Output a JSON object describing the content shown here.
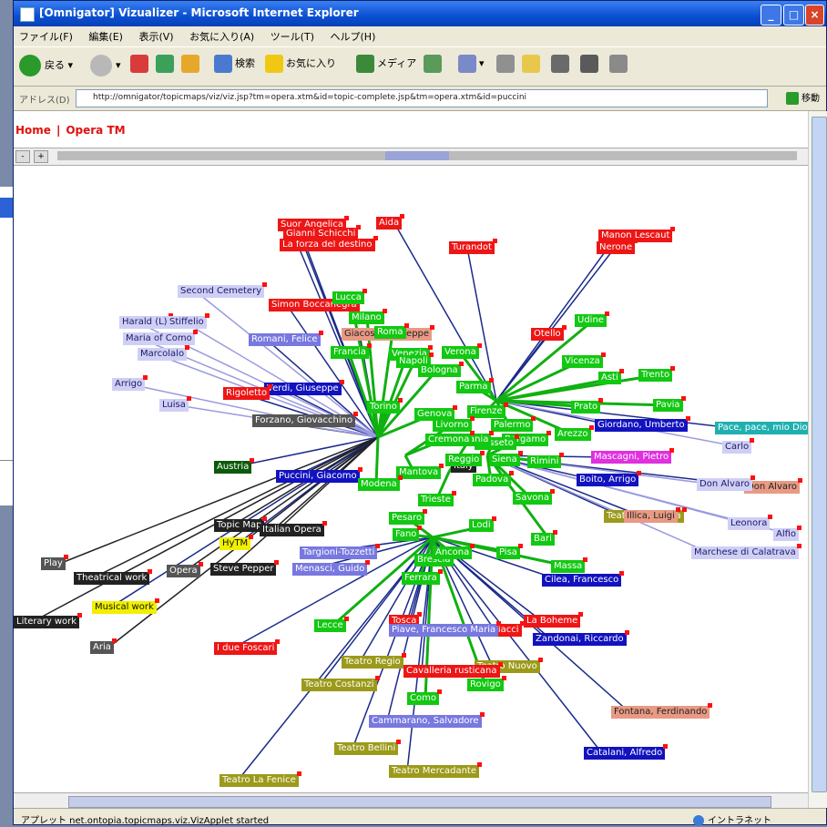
{
  "window": {
    "title": "[Omnigator] Vizualizer - Microsoft Internet Explorer"
  },
  "menu": [
    "ファイル(F)",
    "編集(E)",
    "表示(V)",
    "お気に入り(A)",
    "ツール(T)",
    "ヘルプ(H)"
  ],
  "toolbar": {
    "back": "戻る",
    "search": "検索",
    "favorites": "お気に入り",
    "media": "メディア"
  },
  "address": {
    "label": "アドレス(D)",
    "url": "http://omnigator/topicmaps/viz/viz.jsp?tm=opera.xtm&id=topic-complete.jsp&tm=opera.xtm&id=puccini",
    "go": "移動"
  },
  "breadcrumb": {
    "home": "Home",
    "topicmap": "Opera TM"
  },
  "status": {
    "text": "アプレット net.ontopia.topicmaps.viz.VizApplet started",
    "zone": "イントラネット"
  },
  "icons": [
    "back-icon",
    "forward-icon",
    "stop-icon",
    "refresh-icon",
    "home-icon",
    "search-icon",
    "favorites-icon",
    "media-icon",
    "history-icon",
    "mail-icon",
    "print-icon",
    "edit-icon",
    "go-icon",
    "zone-icon"
  ],
  "colors": {
    "composer": "#12c812",
    "opera": "#ee1515",
    "theatre": "#9c9a1a",
    "person": "#1212c0",
    "librettist": "#7878e0",
    "character": "#cfcff6",
    "selected": "#222222"
  },
  "graph": {
    "nodes": [
      {
        "label": "Puccini, Giacomo",
        "cls": "c-b"
      },
      {
        "label": "Verdi, Giuseppe",
        "cls": "c-b"
      },
      {
        "label": "Tosca",
        "cls": "c-r"
      },
      {
        "label": "La Boheme",
        "cls": "c-r"
      },
      {
        "label": "Turandot",
        "cls": "c-r"
      },
      {
        "label": "Italy",
        "cls": "c-k"
      },
      {
        "label": "Teatro La Fenice",
        "cls": "c-o"
      },
      {
        "label": "Teatro Costanzi",
        "cls": "c-o"
      },
      {
        "label": "Teatro Regio",
        "cls": "c-o"
      },
      {
        "label": "Teatro alla Scala",
        "cls": "c-o"
      },
      {
        "label": "Teatro Nuovo",
        "cls": "c-o"
      },
      {
        "label": "Teatro Bellini",
        "cls": "c-o"
      },
      {
        "label": "Teatro Mercadante",
        "cls": "c-o"
      },
      {
        "label": "Simon Boccanegra",
        "cls": "c-r"
      },
      {
        "label": "La forza del destino",
        "cls": "c-r"
      },
      {
        "label": "Rigoletto",
        "cls": "c-r"
      },
      {
        "label": "Otello",
        "cls": "c-r"
      },
      {
        "label": "Aida",
        "cls": "c-r"
      },
      {
        "label": "Nerone",
        "cls": "c-r"
      },
      {
        "label": "Pagliacci",
        "cls": "c-r"
      },
      {
        "label": "Manon Lescaut",
        "cls": "c-r"
      },
      {
        "label": "Suor Angelica",
        "cls": "c-r"
      },
      {
        "label": "Gianni Schicchi",
        "cls": "c-r"
      },
      {
        "label": "Cavalleria rusticana",
        "cls": "c-r"
      },
      {
        "label": "I due Foscari",
        "cls": "c-r"
      },
      {
        "label": "Don Alvaro",
        "cls": "c-s"
      },
      {
        "label": "Boito, Arrigo",
        "cls": "c-b"
      },
      {
        "label": "Giordano, Umberto",
        "cls": "c-b"
      },
      {
        "label": "Cilea, Francesco",
        "cls": "c-b"
      },
      {
        "label": "Zandonai, Riccardo",
        "cls": "c-b"
      },
      {
        "label": "Catalani, Alfredo",
        "cls": "c-b"
      },
      {
        "label": "Illica, Luigi",
        "cls": "c-s"
      },
      {
        "label": "Giacosa, Giuseppe",
        "cls": "c-s"
      },
      {
        "label": "Fontana, Ferdinando",
        "cls": "c-s"
      },
      {
        "label": "Romani, Felice",
        "cls": "c-p"
      },
      {
        "label": "Piave, Francesco Maria",
        "cls": "c-p"
      },
      {
        "label": "Cammarano, Salvadore",
        "cls": "c-p"
      },
      {
        "label": "Targioni-Tozzetti",
        "cls": "c-p"
      },
      {
        "label": "Menasci, Guido",
        "cls": "c-p"
      },
      {
        "label": "Forzano, Giovacchino",
        "cls": "c-d"
      },
      {
        "label": "Mascagni, Pietro",
        "cls": "c-m"
      },
      {
        "label": "Pace, pace, mio Dio",
        "cls": "c-t"
      },
      {
        "label": "Topic Map",
        "cls": "c-k"
      },
      {
        "label": "Italian Opera",
        "cls": "c-k"
      },
      {
        "label": "HyTM",
        "cls": "c-y"
      },
      {
        "label": "Steve Pepper",
        "cls": "c-k"
      },
      {
        "label": "Opera",
        "cls": "c-d"
      },
      {
        "label": "Theatrical work",
        "cls": "c-k"
      },
      {
        "label": "Musical work",
        "cls": "c-y"
      },
      {
        "label": "Aria",
        "cls": "c-d"
      },
      {
        "label": "Play",
        "cls": "c-d"
      },
      {
        "label": "Literary work",
        "cls": "c-k"
      },
      {
        "label": "Second Cemetery",
        "cls": "c-l"
      },
      {
        "label": "Harald (L)",
        "cls": "c-l"
      },
      {
        "label": "Stiffelio",
        "cls": "c-l"
      },
      {
        "label": "Maria of Como",
        "cls": "c-l"
      },
      {
        "label": "Marcolalo",
        "cls": "c-l"
      },
      {
        "label": "Arrigo",
        "cls": "c-l"
      },
      {
        "label": "Luisa",
        "cls": "c-l"
      },
      {
        "label": "Carlo",
        "cls": "c-l"
      },
      {
        "label": "Don Alvaro",
        "cls": "c-l"
      },
      {
        "label": "Marchese di Calatrava",
        "cls": "c-l"
      },
      {
        "label": "Leonora",
        "cls": "c-l"
      },
      {
        "label": "Alfio",
        "cls": "c-l"
      },
      {
        "label": "Lucca",
        "cls": "c-g"
      },
      {
        "label": "Milano",
        "cls": "c-g"
      },
      {
        "label": "Roma",
        "cls": "c-g"
      },
      {
        "label": "Venezia",
        "cls": "c-g"
      },
      {
        "label": "Napoli",
        "cls": "c-g"
      },
      {
        "label": "Bologna",
        "cls": "c-g"
      },
      {
        "label": "Parma",
        "cls": "c-g"
      },
      {
        "label": "Verona",
        "cls": "c-g"
      },
      {
        "label": "Genova",
        "cls": "c-g"
      },
      {
        "label": "Torino",
        "cls": "c-g"
      },
      {
        "label": "Firenze",
        "cls": "c-g"
      },
      {
        "label": "Livorno",
        "cls": "c-g"
      },
      {
        "label": "Palermo",
        "cls": "c-g"
      },
      {
        "label": "Bergamo",
        "cls": "c-g"
      },
      {
        "label": "Busseto",
        "cls": "c-g"
      },
      {
        "label": "Catania",
        "cls": "c-g"
      },
      {
        "label": "Cremona",
        "cls": "c-g"
      },
      {
        "label": "Reggio",
        "cls": "c-g"
      },
      {
        "label": "Siena",
        "cls": "c-g"
      },
      {
        "label": "Padova",
        "cls": "c-g"
      },
      {
        "label": "Mantova",
        "cls": "c-g"
      },
      {
        "label": "Modena",
        "cls": "c-g"
      },
      {
        "label": "Trieste",
        "cls": "c-g"
      },
      {
        "label": "Pesaro",
        "cls": "c-g"
      },
      {
        "label": "Brescia",
        "cls": "c-g"
      },
      {
        "label": "Ferrara",
        "cls": "c-g"
      },
      {
        "label": "Lecce",
        "cls": "c-g"
      },
      {
        "label": "Rovigo",
        "cls": "c-g"
      },
      {
        "label": "Como",
        "cls": "c-g"
      },
      {
        "label": "Savona",
        "cls": "c-g"
      },
      {
        "label": "Bari",
        "cls": "c-g"
      },
      {
        "label": "Pisa",
        "cls": "c-g"
      },
      {
        "label": "Massa",
        "cls": "c-g"
      },
      {
        "label": "Lodi",
        "cls": "c-g"
      },
      {
        "label": "Fano",
        "cls": "c-g"
      },
      {
        "label": "Ancona",
        "cls": "c-g"
      },
      {
        "label": "Udine",
        "cls": "c-g"
      },
      {
        "label": "Asti",
        "cls": "c-g"
      },
      {
        "label": "Trento",
        "cls": "c-g"
      },
      {
        "label": "Pavia",
        "cls": "c-g"
      },
      {
        "label": "Vicenza",
        "cls": "c-g"
      },
      {
        "label": "Prato",
        "cls": "c-g"
      },
      {
        "label": "Arezzo",
        "cls": "c-g"
      },
      {
        "label": "Rimini",
        "cls": "c-g"
      },
      {
        "label": "Austria",
        "cls": "c-dg"
      },
      {
        "label": "Francia",
        "cls": "c-g"
      }
    ]
  }
}
